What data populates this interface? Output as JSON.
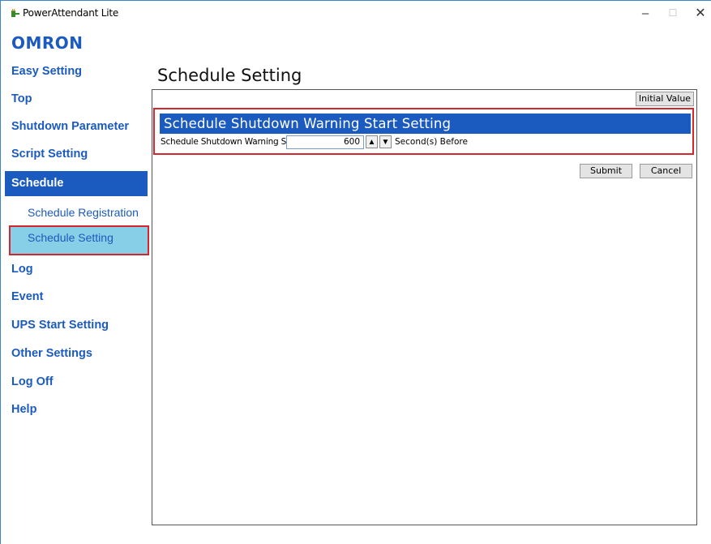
{
  "window": {
    "title": "PowerAttendant Lite",
    "icon": "power-app-icon",
    "controls": {
      "minimize": "–",
      "maximize": "☐",
      "close": "✕"
    }
  },
  "brand": {
    "logo": "OMRON",
    "color": "#1b5bbf"
  },
  "sidebar": {
    "items": [
      {
        "label": "Easy Setting"
      },
      {
        "label": "Top"
      },
      {
        "label": "Shutdown Parameter"
      },
      {
        "label": "Script Setting"
      },
      {
        "label": "Schedule",
        "active": true
      },
      {
        "label": "Log"
      },
      {
        "label": "Event"
      },
      {
        "label": "UPS Start Setting"
      },
      {
        "label": "Other Settings"
      },
      {
        "label": "Log Off"
      },
      {
        "label": "Help"
      }
    ],
    "sub_items": [
      {
        "label": "Schedule Registration"
      },
      {
        "label": "Schedule Setting",
        "active": true
      }
    ],
    "active_color": "#1b5bbf",
    "sub_active_color": "#86cfe6",
    "highlight_color": "#d6262b"
  },
  "main": {
    "page_title": "Schedule Setting",
    "initial_value_label": "Initial Value",
    "section_title": "Schedule Shutdown Warning Start Setting",
    "field": {
      "label": "Schedule Shutdown Warning Start",
      "value": "600",
      "spin_up": "▲",
      "spin_down": "▼",
      "unit": "Second(s) Before"
    },
    "submit_label": "Submit",
    "cancel_label": "Cancel"
  }
}
